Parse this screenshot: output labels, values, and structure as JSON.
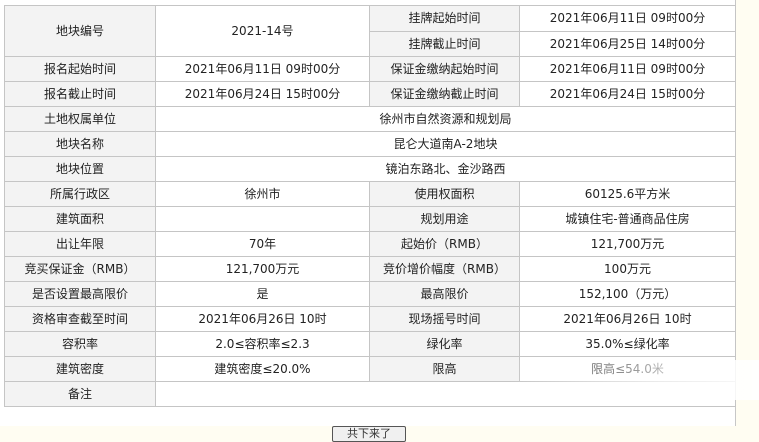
{
  "rows": {
    "block_no_label": "地块编号",
    "block_no_value": "2021-14号",
    "listing_start_label": "挂牌起始时间",
    "listing_start_value": "2021年06月11日 09时00分",
    "listing_end_label": "挂牌截止时间",
    "listing_end_value": "2021年06月25日 14时00分",
    "reg_start_label": "报名起始时间",
    "reg_start_value": "2021年06月11日 09时00分",
    "deposit_start_label": "保证金缴纳起始时间",
    "deposit_start_value": "2021年06月11日 09时00分",
    "reg_end_label": "报名截止时间",
    "reg_end_value": "2021年06月24日 15时00分",
    "deposit_end_label": "保证金缴纳截止时间",
    "deposit_end_value": "2021年06月24日 15时00分",
    "owner_label": "土地权属单位",
    "owner_value": "徐州市自然资源和规划局",
    "name_label": "地块名称",
    "name_value": "昆仑大道南A-2地块",
    "location_label": "地块位置",
    "location_value": "镜泊东路北、金沙路西",
    "district_label": "所属行政区",
    "district_value": "徐州市",
    "use_area_label": "使用权面积",
    "use_area_value": "60125.6平方米",
    "building_area_label": "建筑面积",
    "building_area_value": "",
    "planned_use_label": "规划用途",
    "planned_use_value": "城镇住宅-普通商品住房",
    "term_label": "出让年限",
    "term_value": "70年",
    "start_price_label": "起始价（RMB）",
    "start_price_value": "121,700万元",
    "bid_deposit_label": "竞买保证金（RMB）",
    "bid_deposit_value": "121,700万元",
    "increment_label": "竞价增价幅度（RMB）",
    "increment_value": "100万元",
    "max_limit_set_label": "是否设置最高限价",
    "max_limit_set_value": "是",
    "max_limit_label": "最高限价",
    "max_limit_value": "152,100（万元）",
    "review_deadline_label": "资格审查截至时间",
    "review_deadline_value": "2021年06月26日 10时",
    "onsite_time_label": "现场摇号时间",
    "onsite_time_value": "2021年06月26日 10时",
    "far_label": "容积率",
    "far_value": "2.0≤容积率≤2.3",
    "green_label": "绿化率",
    "green_value": "35.0%≤绿化率",
    "density_label": "建筑密度",
    "density_value": "建筑密度≤20.0%",
    "height_label": "限高",
    "height_value": "限高≤54.0米",
    "remark_label": "备注",
    "remark_value": ""
  },
  "bottom_button_label": "共下来了"
}
